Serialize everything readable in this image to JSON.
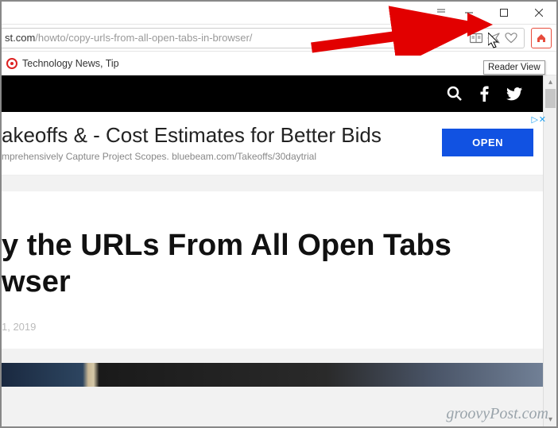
{
  "window": {
    "minimize": "–",
    "maximize": "☐",
    "close": "✕"
  },
  "addressbar": {
    "url_host": "st.com",
    "url_path": "/howto/copy-urls-from-all-open-tabs-in-browser/",
    "reader_view": "Reader View",
    "send": "Send",
    "heart": "Like",
    "home": "Home"
  },
  "bookmarks": {
    "item1": "Technology News, Tip"
  },
  "ad": {
    "title": "akeoffs & - Cost Estimates for Better Bids",
    "subtitle": "mprehensively Capture Project Scopes. bluebeam.com/Takeoffs/30daytrial",
    "button": "OPEN",
    "choices": "▷"
  },
  "article": {
    "title": "y the URLs From All Open Tabs\nwser",
    "date": "1, 2019"
  },
  "tooltip": "Reader View",
  "watermark": "groovyPost.com"
}
